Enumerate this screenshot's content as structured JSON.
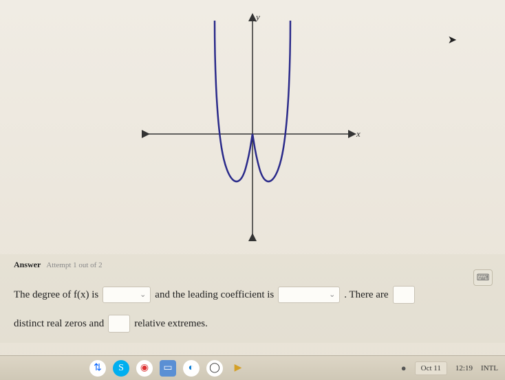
{
  "chart_data": {
    "type": "line",
    "title": "",
    "xlabel": "x",
    "ylabel": "y",
    "description": "Polynomial function graph shaped like a W, opening upward on both ends, with two local minima below the x-axis and one local maximum near the origin on the x-axis.",
    "x_axis_arrows": true,
    "y_axis_arrows": true
  },
  "answer": {
    "header_label": "Answer",
    "attempt_text": "Attempt 1 out of 2",
    "text1": "The degree of f(x) is",
    "text2": "and the leading coefficient is",
    "text3": ". There are",
    "text4": "distinct real zeros and",
    "text5": "relative extremes.",
    "dropdown_icon": "⌄"
  },
  "taskbar": {
    "date": "Oct 11",
    "time": "12:19",
    "tz": "INTL",
    "notification_icon": "●"
  },
  "icons": {
    "calc": "⌨",
    "dropbox": "⇅",
    "skype": "S",
    "app3": "◉",
    "app4": "▭",
    "edge": "◐",
    "chrome": "◯",
    "play": "▶"
  }
}
